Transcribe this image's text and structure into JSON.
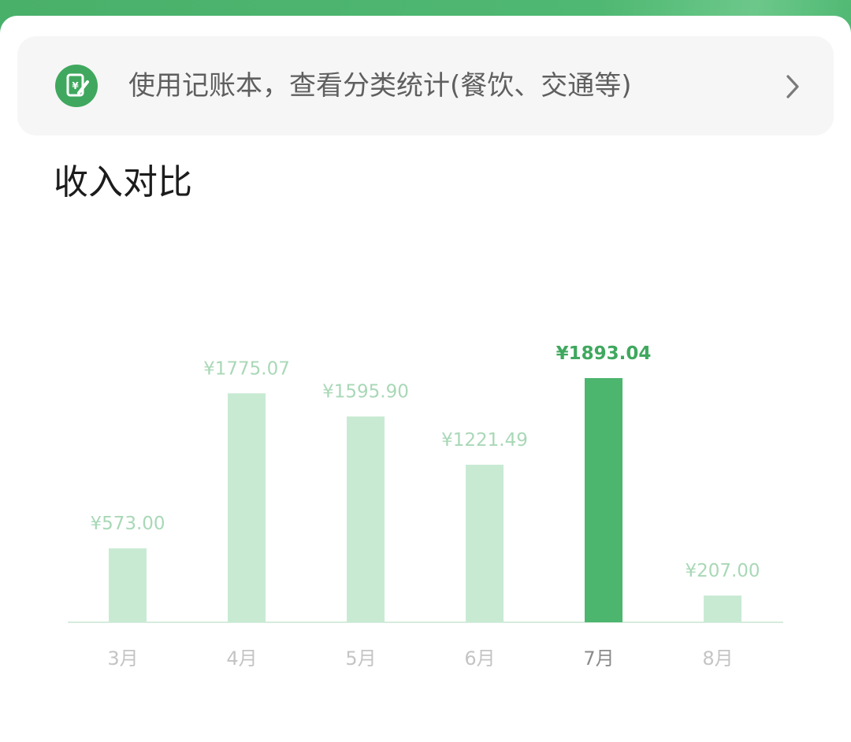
{
  "banner": {
    "icon": "ledger-yen-icon",
    "text": "使用记账本，查看分类统计(餐饮、交通等)",
    "chevron_icon": "chevron-right-icon"
  },
  "section": {
    "title": "收入对比"
  },
  "colors": {
    "header_green": "#4cb56e",
    "bar_normal": "#c8ead3",
    "bar_active": "#4cb56e",
    "label_normal": "#a9d8b7",
    "label_active": "#3fa85e",
    "tick_normal": "#c4c4c4",
    "tick_active": "#8a8a8a",
    "baseline": "#d6ecdd"
  },
  "chart_data": {
    "type": "bar",
    "categories": [
      "3月",
      "4月",
      "5月",
      "6月",
      "7月",
      "8月"
    ],
    "values": [
      573.0,
      1775.07,
      1595.9,
      1221.49,
      1893.04,
      207.0
    ],
    "value_labels": [
      "¥573.00",
      "¥1775.07",
      "¥1595.90",
      "¥1221.49",
      "¥1893.04",
      "¥207.00"
    ],
    "highlighted_index": 4,
    "title": "",
    "xlabel": "",
    "ylabel": "",
    "ylim": [
      0,
      1893.04
    ],
    "grid": false,
    "legend": "none"
  }
}
